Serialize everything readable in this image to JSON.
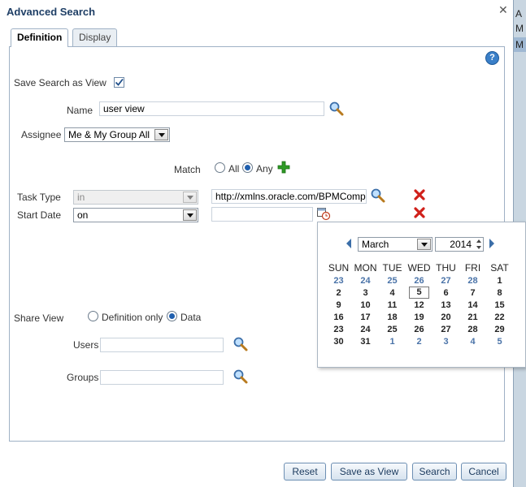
{
  "dialog": {
    "title": "Advanced Search"
  },
  "tabs": [
    {
      "label": "Definition",
      "active": true
    },
    {
      "label": "Display",
      "active": false
    }
  ],
  "background": {
    "rows": [
      "A",
      "M",
      "M"
    ]
  },
  "form": {
    "save_as_view": {
      "label": "Save Search as View",
      "checked": true
    },
    "name": {
      "label": "Name",
      "value": "user view"
    },
    "assignee": {
      "label": "Assignee",
      "value": "Me & My Group All"
    },
    "match": {
      "label": "Match",
      "options": [
        "All",
        "Any"
      ],
      "selected": "Any"
    },
    "task_type": {
      "label": "Task Type",
      "operator": "in",
      "value": "http://xmlns.oracle.com/BPMComp"
    },
    "start_date": {
      "label": "Start Date",
      "operator": "on",
      "value": ""
    },
    "share_view": {
      "label": "Share View",
      "options": [
        "Definition only",
        "Data"
      ],
      "selected": "Data"
    },
    "users": {
      "label": "Users",
      "value": ""
    },
    "groups": {
      "label": "Groups",
      "value": ""
    }
  },
  "calendar": {
    "month": "March",
    "year": "2014",
    "weekdays": [
      "SUN",
      "MON",
      "TUE",
      "WED",
      "THU",
      "FRI",
      "SAT"
    ],
    "selected_day": "5",
    "weeks": [
      [
        "23",
        "24",
        "25",
        "26",
        "27",
        "28",
        "1"
      ],
      [
        "2",
        "3",
        "4",
        "5",
        "6",
        "7",
        "8"
      ],
      [
        "9",
        "10",
        "11",
        "12",
        "13",
        "14",
        "15"
      ],
      [
        "16",
        "17",
        "18",
        "19",
        "20",
        "21",
        "22"
      ],
      [
        "23",
        "24",
        "25",
        "26",
        "27",
        "28",
        "29"
      ],
      [
        "30",
        "31",
        "1",
        "2",
        "3",
        "4",
        "5"
      ]
    ]
  },
  "buttons": {
    "reset": "Reset",
    "save_as_view": "Save as View",
    "search": "Search",
    "cancel": "Cancel"
  },
  "colors": {
    "title": "#1f3f66",
    "accent": "#1f5fae",
    "delete_red": "#d0201a",
    "add_green": "#2e9a25"
  }
}
